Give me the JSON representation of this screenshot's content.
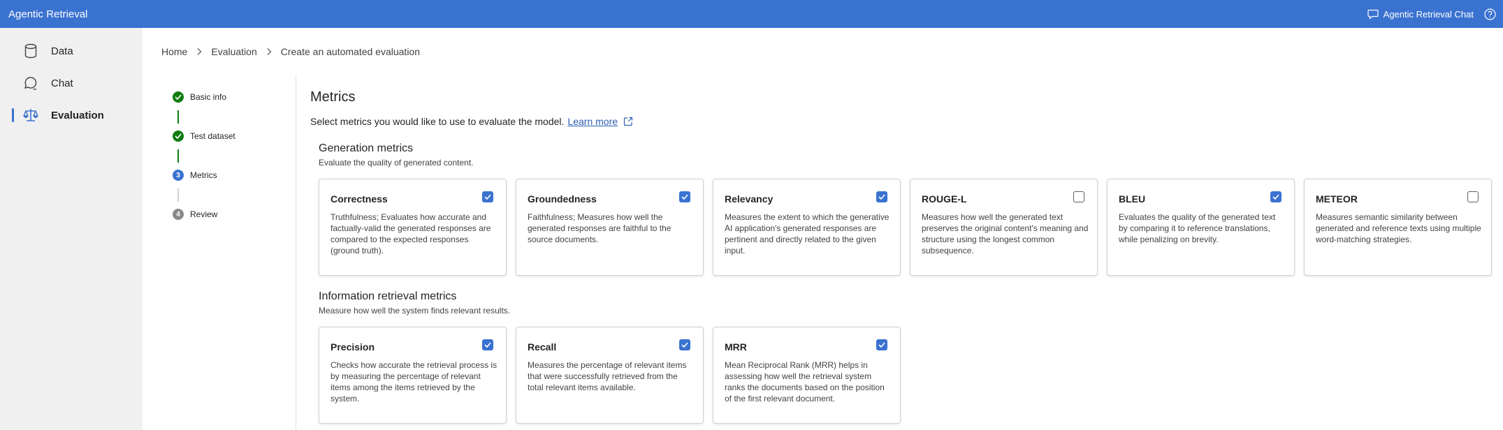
{
  "app": {
    "title": "Agentic Retrieval",
    "chat_link_label": "Agentic Retrieval Chat",
    "accent_color": "#3a72d0"
  },
  "sidebar": {
    "items": [
      {
        "label": "Data",
        "icon": "database-icon",
        "active": false
      },
      {
        "label": "Chat",
        "icon": "chat-icon",
        "active": false
      },
      {
        "label": "Evaluation",
        "icon": "scales-icon",
        "active": true
      }
    ]
  },
  "breadcrumb": [
    "Home",
    "Evaluation",
    "Create an automated evaluation"
  ],
  "stepper": {
    "steps": [
      {
        "label": "Basic info",
        "state": "done",
        "number": ""
      },
      {
        "label": "Test dataset",
        "state": "done",
        "number": ""
      },
      {
        "label": "Metrics",
        "state": "current",
        "number": "3"
      },
      {
        "label": "Review",
        "state": "todo",
        "number": "4"
      }
    ]
  },
  "page": {
    "title": "Metrics",
    "description": "Select metrics you would like to use to evaluate the model.",
    "learn_more": "Learn more"
  },
  "generation": {
    "title": "Generation metrics",
    "subtitle": "Evaluate the quality of generated content.",
    "cards": [
      {
        "title": "Correctness",
        "checked": true,
        "desc": "Truthfulness; Evaluates how accurate and factually-valid the generated responses are compared to the expected responses (ground truth)."
      },
      {
        "title": "Groundedness",
        "checked": true,
        "desc": "Faithfulness; Measures how well the generated responses are faithful to the source documents."
      },
      {
        "title": "Relevancy",
        "checked": true,
        "desc": "Measures the extent to which the generative AI application's generated responses are pertinent and directly related to the given input."
      },
      {
        "title": "ROUGE-L",
        "checked": false,
        "desc": "Measures how well the generated text preserves the original content's meaning and structure using the longest common subsequence."
      },
      {
        "title": "BLEU",
        "checked": true,
        "desc": "Evaluates the quality of the generated text by comparing it to reference translations, while penalizing on brevity."
      },
      {
        "title": "METEOR",
        "checked": false,
        "desc": "Measures semantic similarity between generated and reference texts using multiple word-matching strategies."
      }
    ]
  },
  "retrieval": {
    "title": "Information retrieval metrics",
    "subtitle": "Measure how well the system finds relevant results.",
    "cards": [
      {
        "title": "Precision",
        "checked": true,
        "desc": "Checks how accurate the retrieval process is by measuring the percentage of relevant items among the items retrieved by the system."
      },
      {
        "title": "Recall",
        "checked": true,
        "desc": "Measures the percentage of relevant items that were successfully retrieved from the total relevant items available."
      },
      {
        "title": "MRR",
        "checked": true,
        "desc": "Mean Reciprocal Rank (MRR) helps in assessing how well the retrieval system ranks the documents based on the position of the first relevant document."
      }
    ]
  }
}
